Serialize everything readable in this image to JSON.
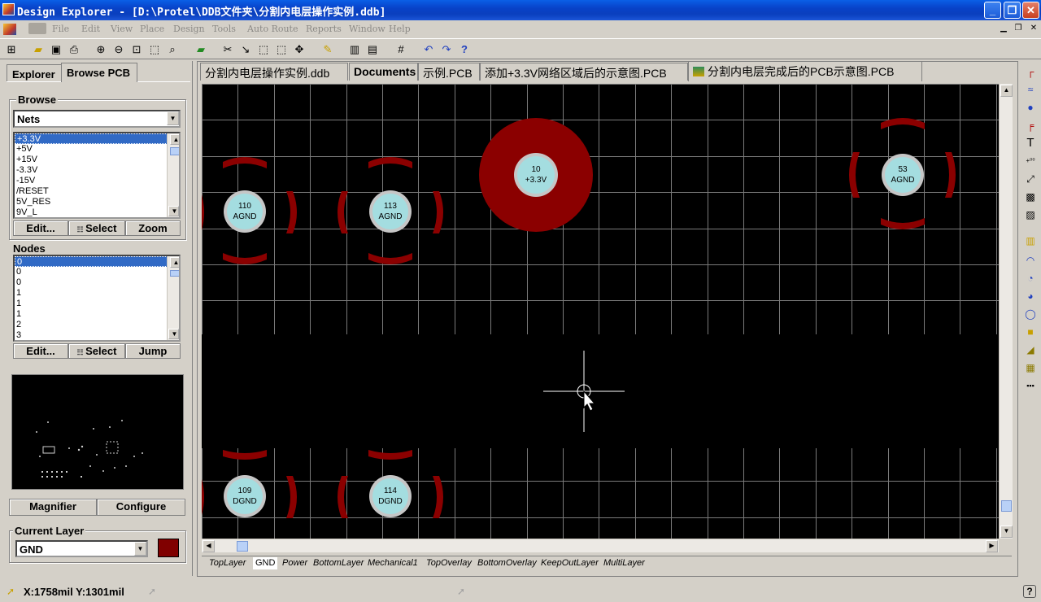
{
  "window": {
    "title": "Design Explorer - [D:\\Protel\\DDB文件夹\\分割内电层操作实例.ddb]",
    "minimize": "_",
    "restore": "❐",
    "close": "✕"
  },
  "menu": [
    "File",
    "Edit",
    "View",
    "Place",
    "Design",
    "Tools",
    "Auto Route",
    "Reports",
    "Window",
    "Help"
  ],
  "panel": {
    "tabs": [
      "Explorer",
      "Browse PCB"
    ],
    "browse": {
      "label": "Browse",
      "mode": "Nets",
      "nets": [
        "+3.3V",
        "+5V",
        "+15V",
        "-3.3V",
        "-15V",
        "/RESET",
        "5V_RES",
        "9V_L"
      ],
      "selected_net": "+3.3V",
      "buttons": [
        "Edit...",
        "Select",
        "Zoom"
      ]
    },
    "nodes": {
      "label": "Nodes",
      "items": [
        "0",
        "0",
        "0",
        "1",
        "1",
        "1",
        "2",
        "3"
      ],
      "buttons": [
        "Edit...",
        "Select",
        "Jump"
      ]
    },
    "preview_buttons": [
      "Magnifier",
      "Configure"
    ],
    "current_layer": {
      "label": "Current Layer",
      "value": "GND",
      "color": "#800000"
    }
  },
  "doc_tabs": [
    "分割内电层操作实例.ddb",
    "Documents",
    "示例.PCB",
    "添加+3.3V网络区域后的示意图.PCB",
    "分割内电层完成后的PCB示意图.PCB"
  ],
  "active_doc_tab": "分割内电层完成后的PCB示意图.PCB",
  "pcb": {
    "pads": [
      {
        "num": "110",
        "net": "AGND"
      },
      {
        "num": "113",
        "net": "AGND"
      },
      {
        "num": "10",
        "net": "+3.3V"
      },
      {
        "num": "53",
        "net": "AGND"
      },
      {
        "num": "109",
        "net": "DGND"
      },
      {
        "num": "114",
        "net": "DGND"
      }
    ],
    "colors": {
      "background": "#000000",
      "grid": "#7a7a7a",
      "plane": "#8b0000",
      "pad": "#c6c6c6",
      "pad_hole": "#a4dde0"
    }
  },
  "layers": [
    "TopLayer",
    "GND",
    "Power",
    "BottomLayer",
    "Mechanical1",
    "TopOverlay",
    "BottomOverlay",
    "KeepOutLayer",
    "MultiLayer"
  ],
  "active_layer": "GND",
  "status": {
    "coords": "X:1758mil Y:1301mil"
  }
}
